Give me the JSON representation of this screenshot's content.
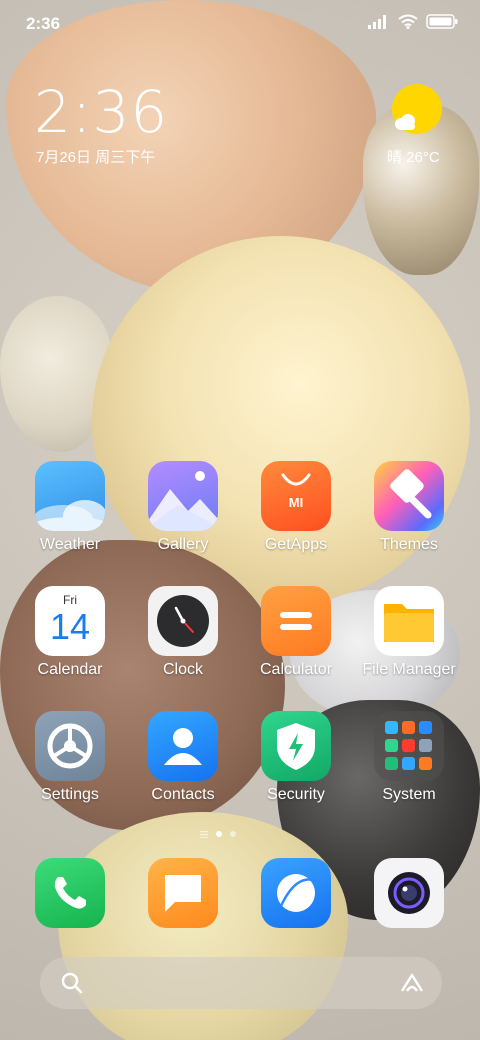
{
  "status_bar": {
    "time": "2:36"
  },
  "clock_widget": {
    "time": "2:36",
    "date": "7月26日 周三下午"
  },
  "weather_widget": {
    "text": "晴 26°C",
    "sun_color": "#ffd600"
  },
  "apps_row1": [
    {
      "label": "Weather",
      "icon": "weather-icon"
    },
    {
      "label": "Gallery",
      "icon": "gallery-icon"
    },
    {
      "label": "GetApps",
      "icon": "getapps-icon",
      "badge_text": "MI"
    },
    {
      "label": "Themes",
      "icon": "themes-icon"
    }
  ],
  "apps_row2": [
    {
      "label": "Calendar",
      "icon": "calendar-icon",
      "day_name": "Fri",
      "day_number": "14"
    },
    {
      "label": "Clock",
      "icon": "clock-icon"
    },
    {
      "label": "Calculator",
      "icon": "calculator-icon"
    },
    {
      "label": "File Manager",
      "icon": "folder-icon"
    }
  ],
  "apps_row3": [
    {
      "label": "Settings",
      "icon": "gear-icon"
    },
    {
      "label": "Contacts",
      "icon": "contacts-icon"
    },
    {
      "label": "Security",
      "icon": "shield-icon"
    },
    {
      "label": "System",
      "icon": "folder-grid-icon"
    }
  ],
  "dock": [
    {
      "icon": "phone-icon"
    },
    {
      "icon": "messages-icon"
    },
    {
      "icon": "browser-icon"
    },
    {
      "icon": "camera-icon"
    }
  ],
  "page_indicator": {
    "pages": 2,
    "active": 1
  },
  "colors": {
    "weather": "#3a9bf0",
    "gallery": "#8a7cf2",
    "getapps": "#ff6a2a",
    "calculator": "#ff8a2b",
    "contacts": "#1a8cff",
    "security": "#1fbf7a",
    "phone": "#22c55e",
    "messages": "#ff9f2e",
    "browser": "#2a8cff"
  }
}
